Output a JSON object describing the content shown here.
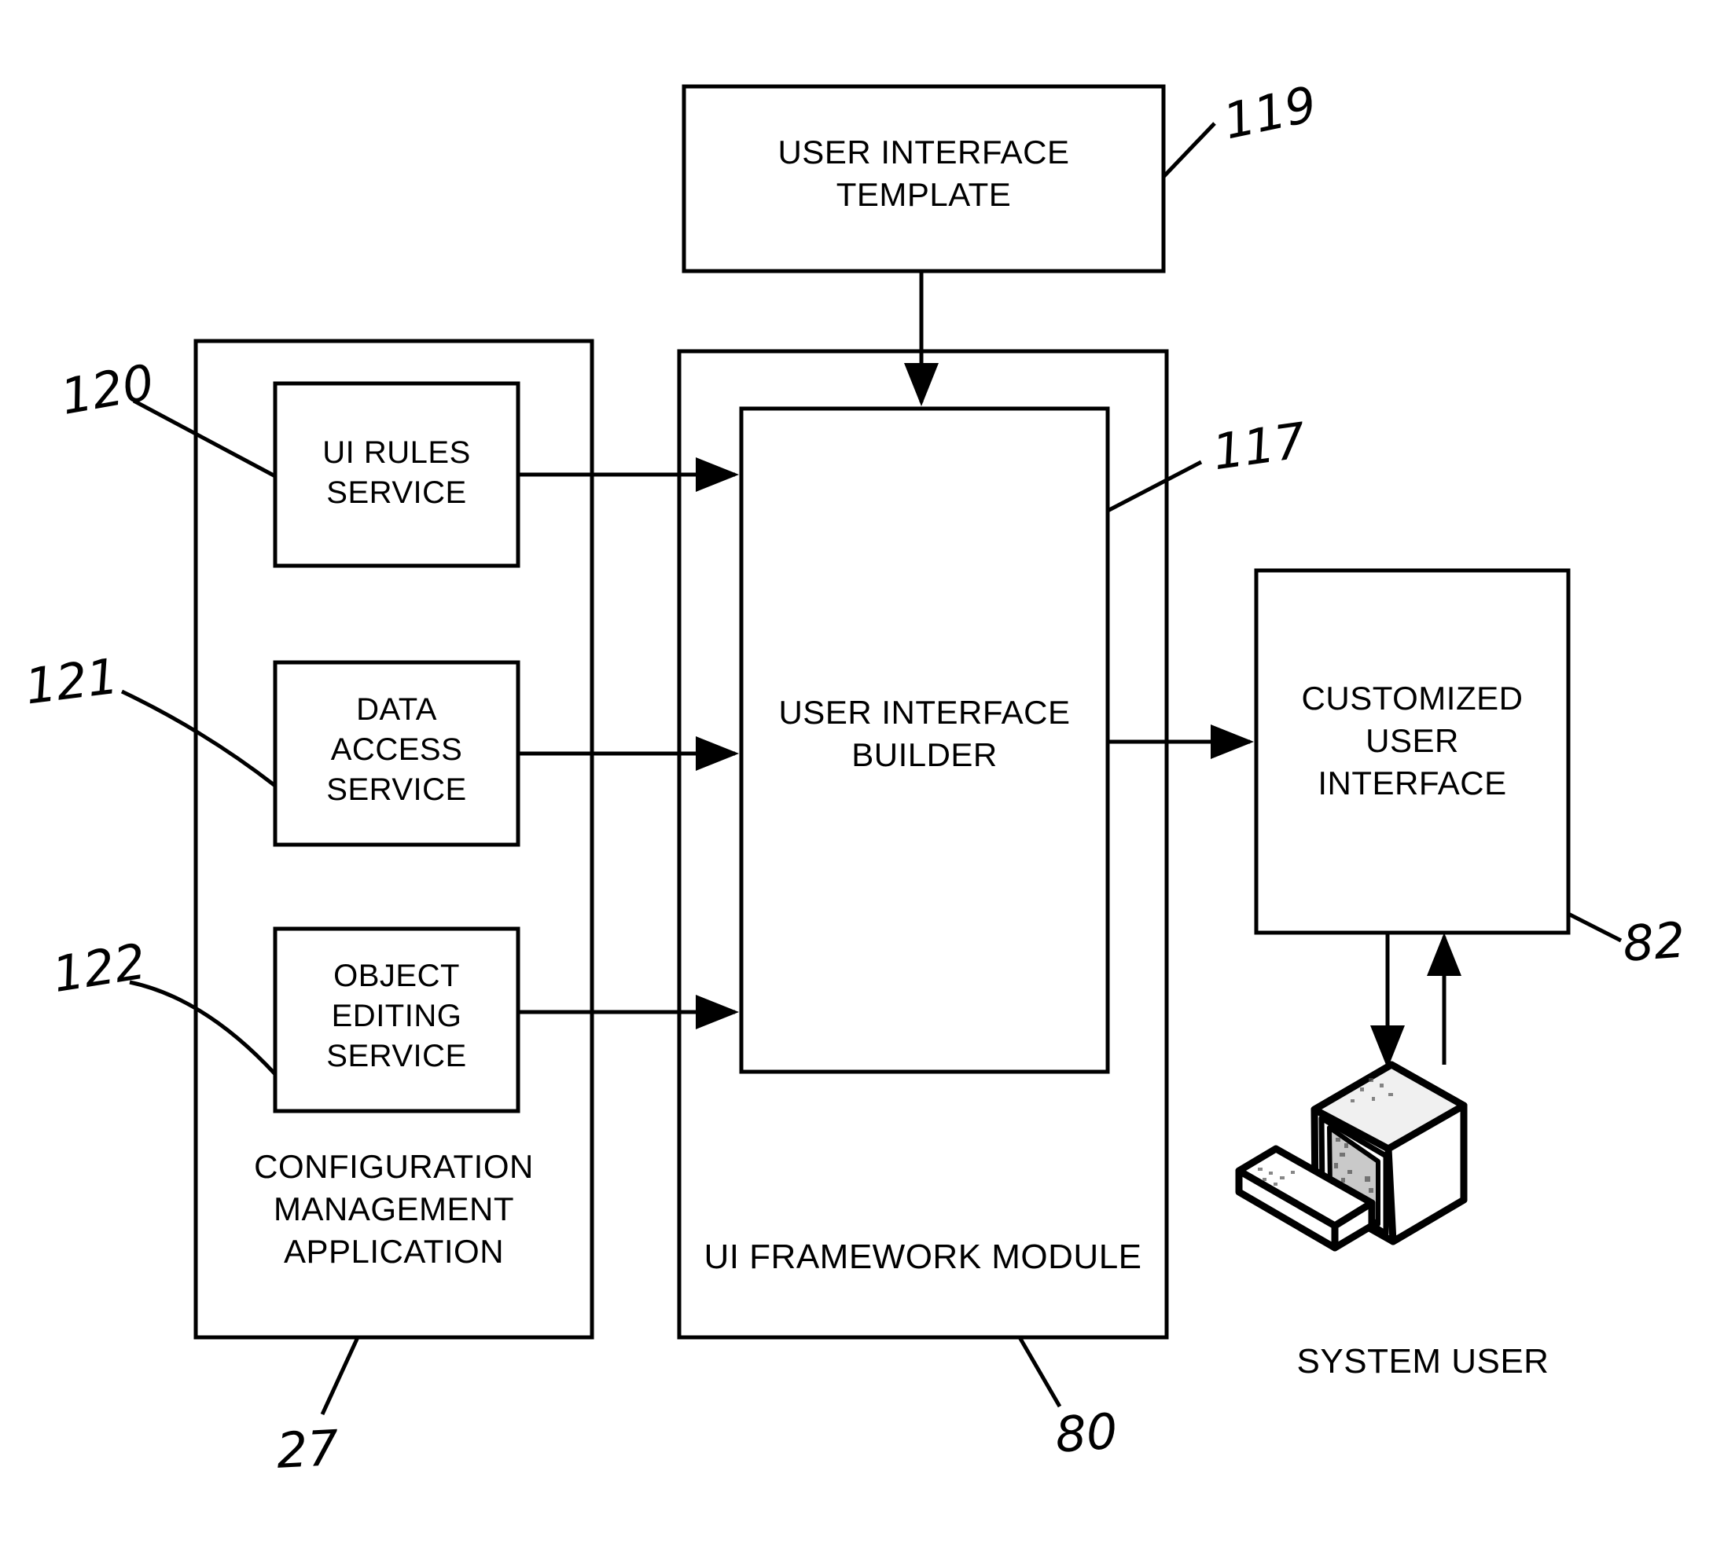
{
  "figure": {
    "type": "patent-block-diagram",
    "background_color": "#ffffff",
    "line_color": "#000000"
  },
  "boxes": {
    "ui_template": {
      "label": "USER INTERFACE\nTEMPLATE"
    },
    "ui_builder": {
      "label": "USER INTERFACE\nBUILDER"
    },
    "customized_ui": {
      "label": "CUSTOMIZED\nUSER\nINTERFACE"
    },
    "ui_rules_service": {
      "label": "UI RULES\nSERVICE"
    },
    "data_access_service": {
      "label": "DATA\nACCESS\nSERVICE"
    },
    "object_editing_service": {
      "label": "OBJECT\nEDITING\nSERVICE"
    },
    "config_mgmt_app": {
      "label": "CONFIGURATION\nMANAGEMENT\nAPPLICATION"
    },
    "ui_framework_module": {
      "label": "UI FRAMEWORK MODULE"
    }
  },
  "captions": {
    "system_user": "SYSTEM USER"
  },
  "reference_numerals": {
    "ui_template": "119",
    "ui_builder": "117",
    "customized_ui": "82",
    "ui_rules_service": "120",
    "data_access_service": "121",
    "object_editing_service": "122",
    "config_mgmt_app": "27",
    "ui_framework_module": "80"
  },
  "connections": [
    {
      "from": "ui_template",
      "to": "ui_builder",
      "direction": "down"
    },
    {
      "from": "ui_rules_service",
      "to": "ui_builder",
      "direction": "right"
    },
    {
      "from": "data_access_service",
      "to": "ui_builder",
      "direction": "right"
    },
    {
      "from": "object_editing_service",
      "to": "ui_builder",
      "direction": "right"
    },
    {
      "from": "ui_builder",
      "to": "customized_ui",
      "direction": "right"
    },
    {
      "from": "customized_ui",
      "to": "system_user_monitor",
      "direction": "down"
    },
    {
      "from": "system_user_monitor",
      "to": "customized_ui",
      "direction": "up"
    }
  ]
}
